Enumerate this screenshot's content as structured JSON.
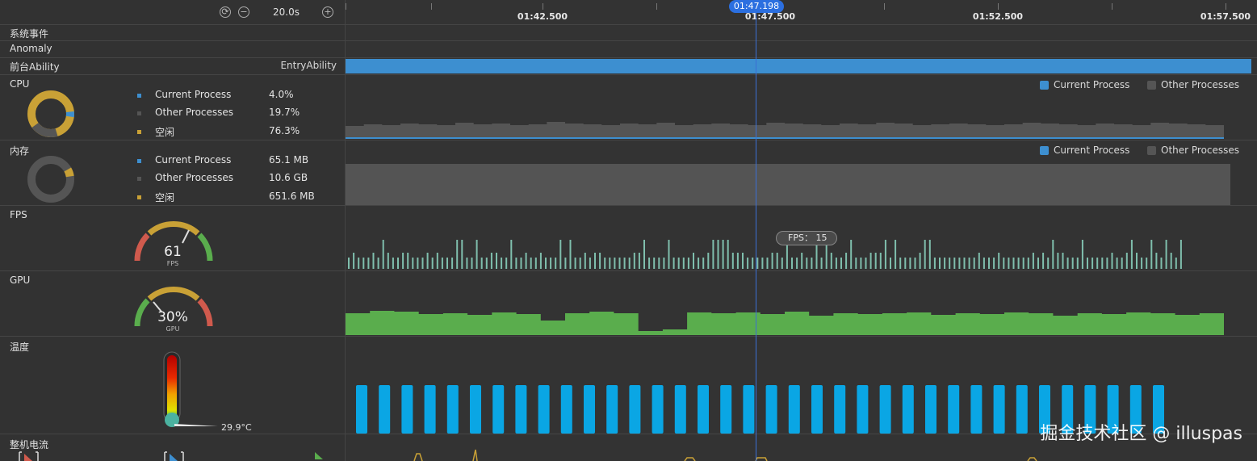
{
  "toolbar": {
    "zoom": "20.0s",
    "reset_icon": "reset-icon",
    "zoom_out_icon": "zoom-out-icon",
    "zoom_in_icon": "zoom-in-icon"
  },
  "timeline": {
    "ticks": [
      "01:42.500",
      "01:47.500",
      "01:52.500",
      "01:57.500"
    ],
    "cursor": "01:47.198"
  },
  "rows": {
    "system_events": "系统事件",
    "anomaly": "Anomaly",
    "foreground": {
      "label": "前台Ability",
      "value": "EntryAbility"
    },
    "cpu": {
      "label": "CPU",
      "stats": [
        {
          "name": "Current Process",
          "value": "4.0%"
        },
        {
          "name": "Other Processes",
          "value": "19.7%"
        },
        {
          "name": "空闲",
          "value": "76.3%"
        }
      ],
      "fractions": [
        0.04,
        0.197,
        0.763
      ]
    },
    "memory": {
      "label": "内存",
      "stats": [
        {
          "name": "Current Process",
          "value": "65.1 MB"
        },
        {
          "name": "Other Processes",
          "value": "10.6 GB"
        },
        {
          "name": "空闲",
          "value": "651.6 MB"
        }
      ],
      "fractions": [
        0.006,
        0.935,
        0.059
      ]
    },
    "fps": {
      "label": "FPS",
      "value": "61",
      "unit": "FPS",
      "tooltip": "FPS： 15"
    },
    "gpu": {
      "label": "GPU",
      "value": "30%",
      "unit": "GPU"
    },
    "temperature": {
      "label": "温度",
      "value": "29.9°C"
    },
    "power": {
      "label": "整机电流"
    }
  },
  "legend": {
    "current": "Current Process",
    "other": "Other Processes"
  },
  "colors": {
    "current": "#3d8fd0",
    "other": "#555555",
    "idle": "#c9a136",
    "fps_bar": "#7fbfad",
    "gpu_fill": "#5aad4d",
    "temp_bar": "#0aa6e4",
    "cursor": "#3b6fd4"
  },
  "watermark": "掘金技术社区 @ illuspas"
}
